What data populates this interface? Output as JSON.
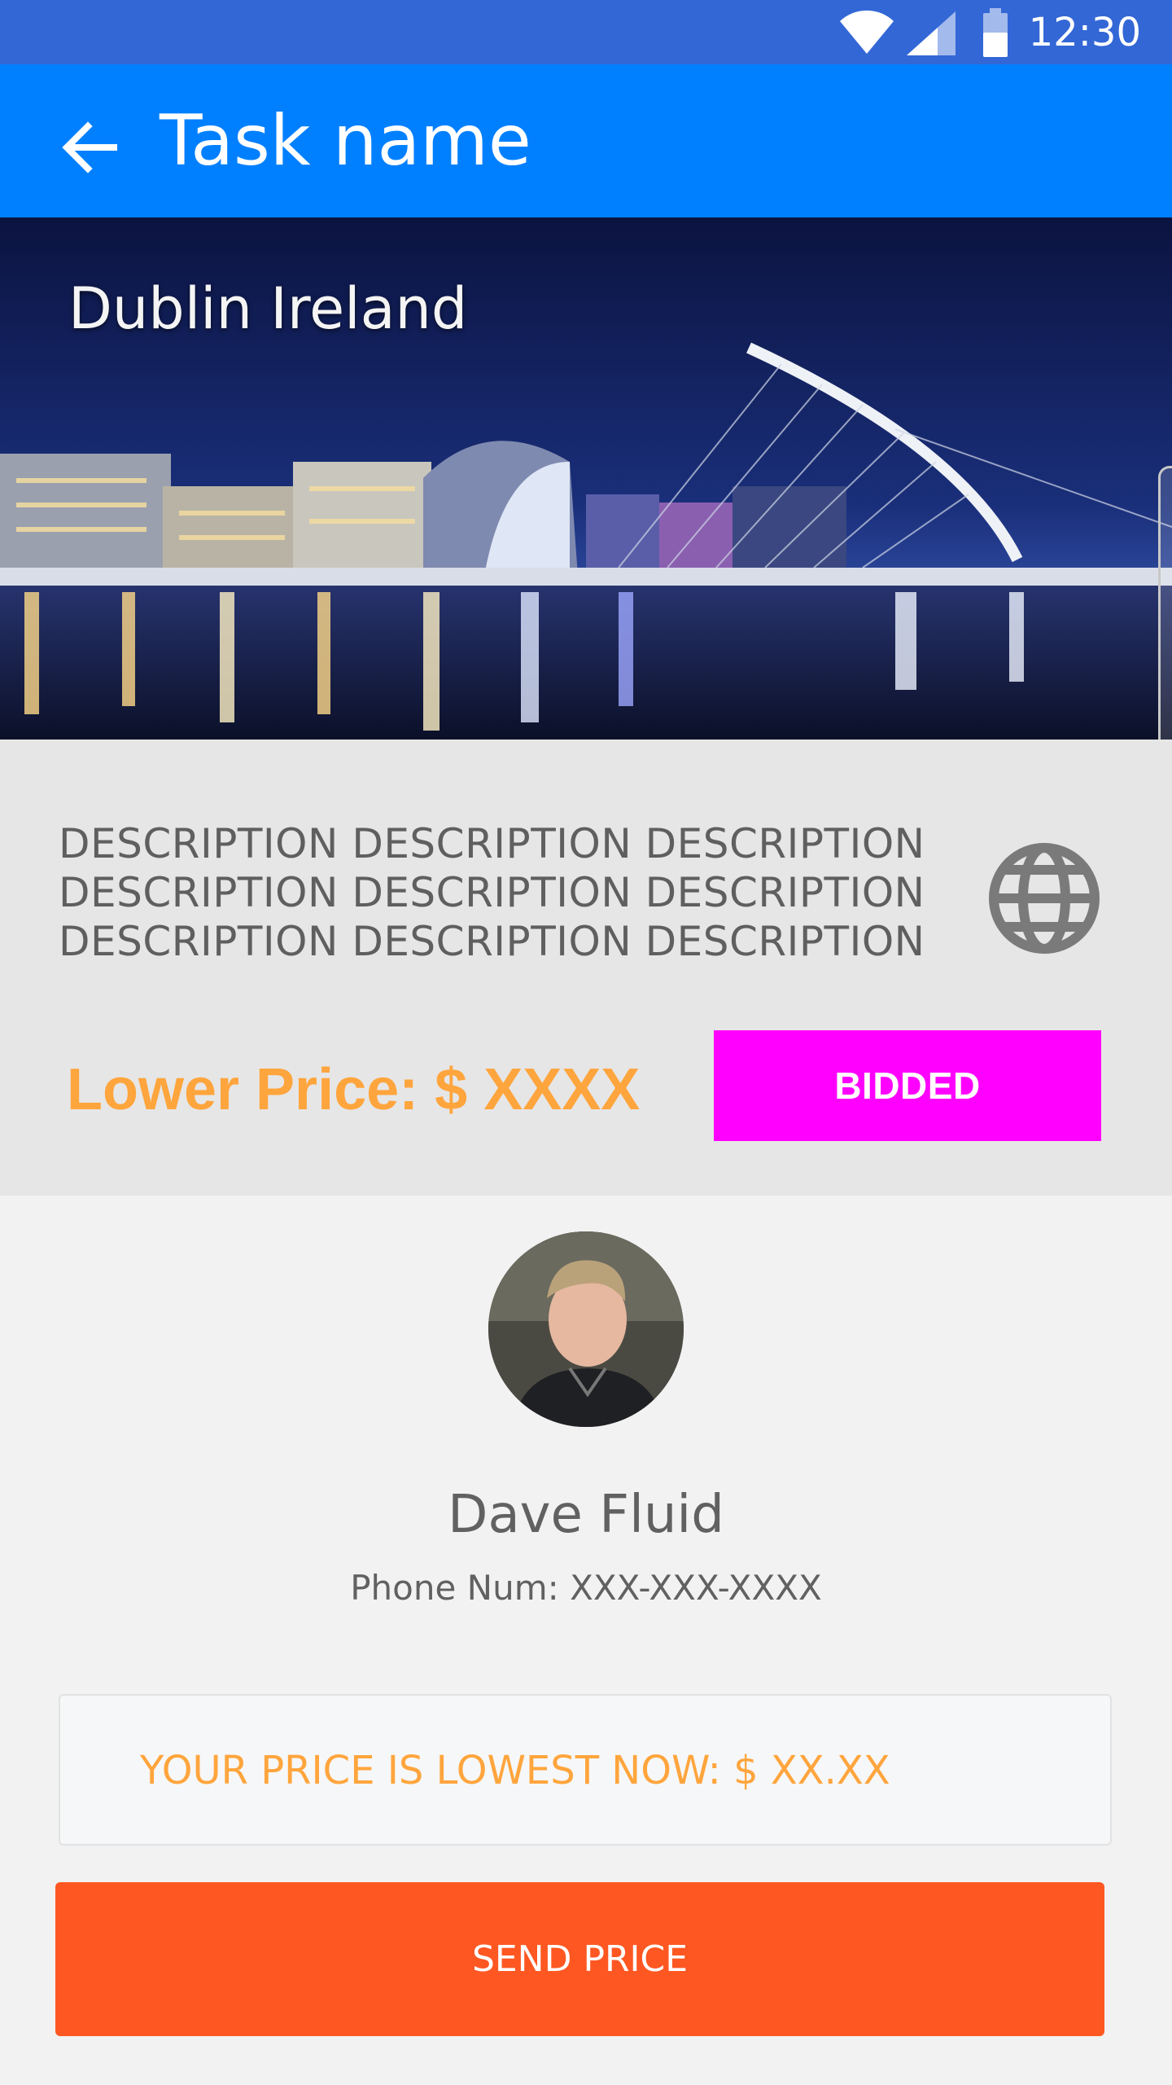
{
  "status_bar": {
    "time": "12:30"
  },
  "app_bar": {
    "title": "Task name"
  },
  "hero": {
    "caption": "Dublin Ireland"
  },
  "task": {
    "description_lines": [
      "DESCRIPTION DESCRIPTION DESCRIPTION",
      "DESCRIPTION DESCRIPTION DESCRIPTION",
      "DESCRIPTION DESCRIPTION DESCRIPTION"
    ],
    "lower_price": "Lower Price: $ XXXX",
    "bid_label": "BIDDED"
  },
  "user": {
    "name": "Dave Fluid",
    "phone": "Phone Num: XXX-XXX-XXXX"
  },
  "notice": {
    "text": "YOUR PRICE IS LOWEST NOW: $ XX.XX"
  },
  "actions": {
    "send_label": "SEND PRICE"
  },
  "colors": {
    "status_bar": "#3367d6",
    "app_bar": "#0080ff",
    "bid_button": "#ff00ff",
    "send_button": "#ff5722",
    "price_text": "#ffa53d"
  },
  "icons": [
    "wifi-icon",
    "signal-icon",
    "battery-icon",
    "back-arrow-icon",
    "globe-icon"
  ]
}
